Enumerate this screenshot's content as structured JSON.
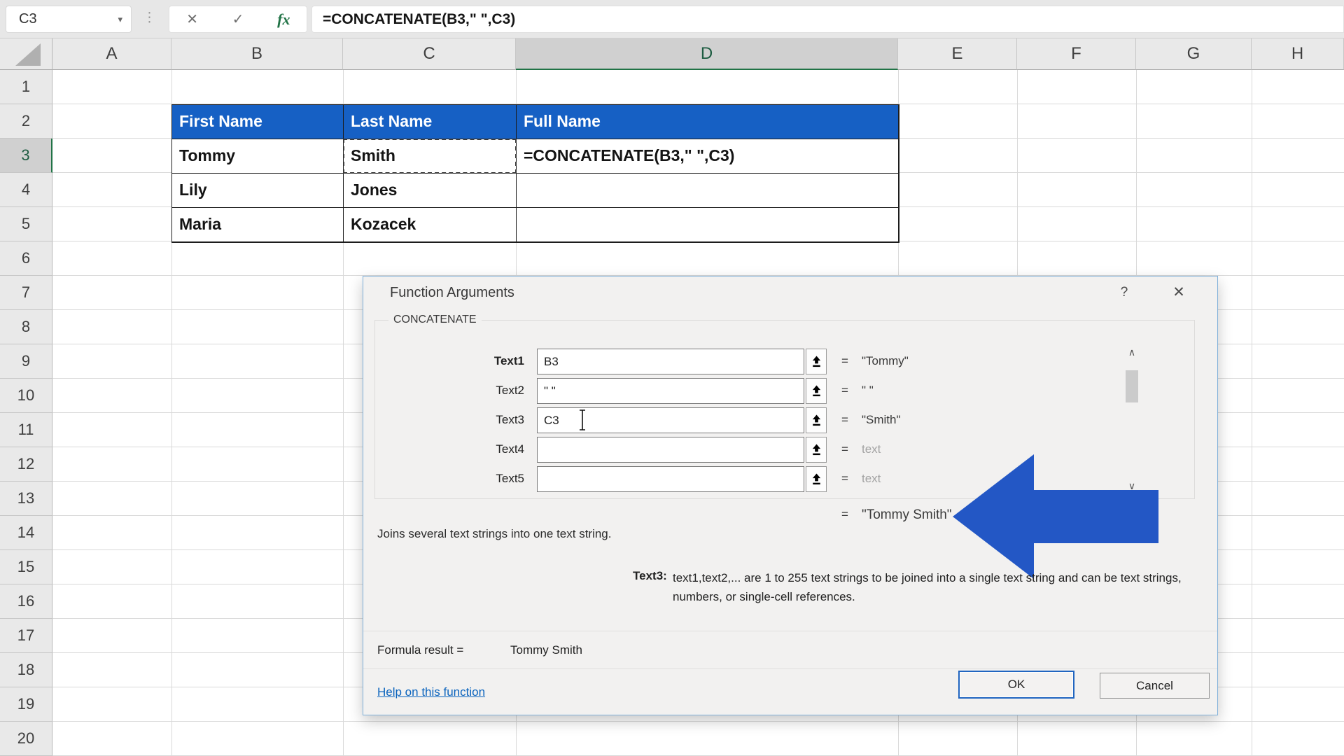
{
  "formula_bar": {
    "name_box": "C3",
    "caret_glyph": "▾",
    "dots_glyph": "⋮",
    "cancel_glyph": "✕",
    "enter_glyph": "✓",
    "fx_glyph": "fx",
    "formula": "=CONCATENATE(B3,\" \",C3)"
  },
  "grid": {
    "columns": [
      "A",
      "B",
      "C",
      "D",
      "E",
      "F",
      "G",
      "H"
    ],
    "rows": [
      "1",
      "2",
      "3",
      "4",
      "5",
      "6",
      "7",
      "8",
      "9",
      "10",
      "11",
      "12",
      "13",
      "14",
      "15",
      "16",
      "17",
      "18",
      "19",
      "20"
    ],
    "active_column": "D",
    "active_row": "3"
  },
  "table": {
    "header_bg": "#1660c4",
    "headers": [
      "First Name",
      "Last Name",
      "Full Name"
    ],
    "rows": [
      [
        "Tommy",
        "Smith",
        "=CONCATENATE(B3,\" \",C3)"
      ],
      [
        "Lily",
        "Jones",
        ""
      ],
      [
        "Maria",
        "Kozacek",
        ""
      ]
    ]
  },
  "dialog": {
    "title": "Function Arguments",
    "help_glyph": "?",
    "close_glyph": "✕",
    "function_name": "CONCATENATE",
    "equals": "=",
    "scroll_up_glyph": "∧",
    "scroll_down_glyph": "∨",
    "args": [
      {
        "label": "Text1",
        "value": "B3",
        "result": "\"Tommy\""
      },
      {
        "label": "Text2",
        "value": "\" \"",
        "result": "\" \""
      },
      {
        "label": "Text3",
        "value": "C3",
        "result": "\"Smith\""
      },
      {
        "label": "Text4",
        "value": "",
        "result": "text"
      },
      {
        "label": "Text5",
        "value": "",
        "result": "text"
      }
    ],
    "overall_result": "\"Tommy Smith\"",
    "arrow_color": "#2357c5",
    "description": "Joins several text strings into one text string.",
    "arg_help_label": "Text3:",
    "arg_help_text": "text1,text2,... are 1 to 255 text strings to be joined into a single text string and can be text strings, numbers, or single-cell references.",
    "formula_result_label": "Formula result =",
    "formula_result_value": "Tommy Smith",
    "help_link": "Help on this function",
    "ok_label": "OK",
    "cancel_label": "Cancel"
  }
}
